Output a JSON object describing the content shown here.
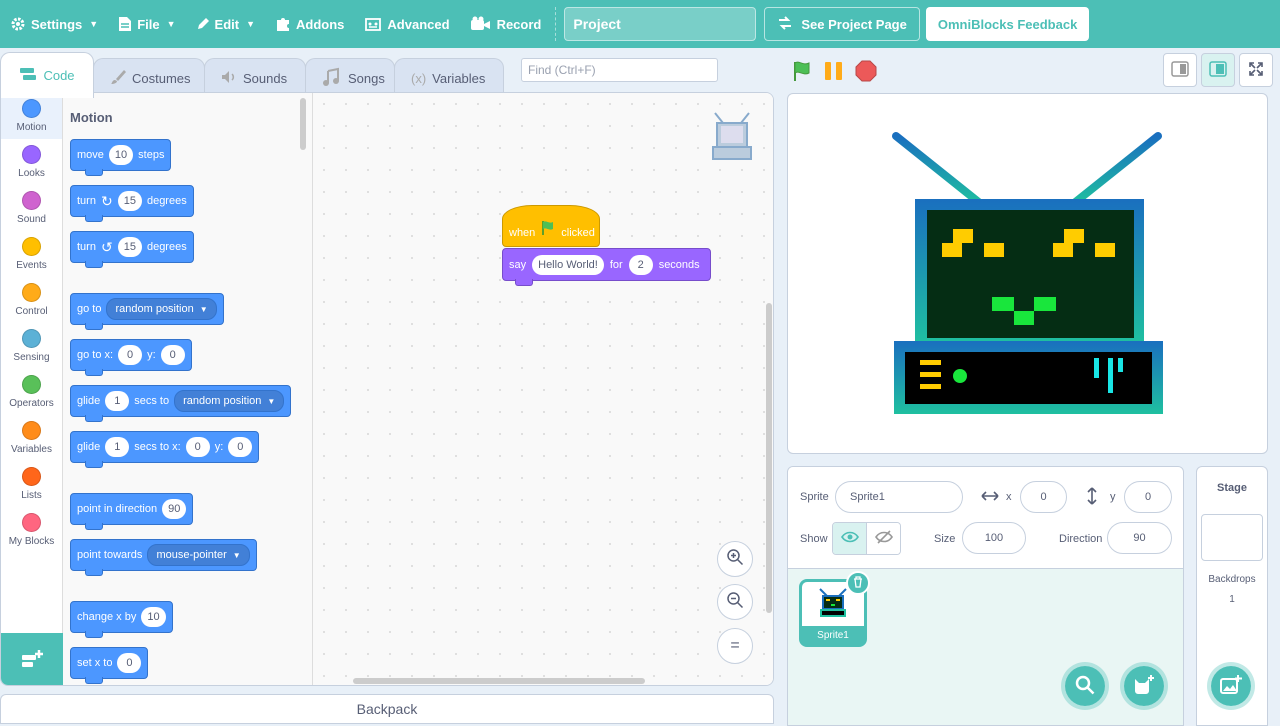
{
  "menu": {
    "settings": "Settings",
    "file": "File",
    "edit": "Edit",
    "addons": "Addons",
    "advanced": "Advanced",
    "record": "Record",
    "project_title": "Project",
    "see_project_page": "See Project Page",
    "feedback": "OmniBlocks Feedback"
  },
  "tabs": [
    {
      "label": "Code",
      "icon": "code-icon",
      "active": true
    },
    {
      "label": "Costumes",
      "icon": "brush-icon"
    },
    {
      "label": "Sounds",
      "icon": "speaker-icon"
    },
    {
      "label": "Songs",
      "icon": "music-note-icon"
    },
    {
      "label": "Variables",
      "icon": "variable-icon"
    }
  ],
  "search": {
    "placeholder": "Find (Ctrl+F)"
  },
  "categories": [
    {
      "label": "Motion",
      "color": "#4c97ff"
    },
    {
      "label": "Looks",
      "color": "#9966ff"
    },
    {
      "label": "Sound",
      "color": "#cf63cf"
    },
    {
      "label": "Events",
      "color": "#ffbf00"
    },
    {
      "label": "Control",
      "color": "#ffab19"
    },
    {
      "label": "Sensing",
      "color": "#5cb1d6"
    },
    {
      "label": "Operators",
      "color": "#59c059"
    },
    {
      "label": "Variables",
      "color": "#ff8c1a"
    },
    {
      "label": "Lists",
      "color": "#ff661a"
    },
    {
      "label": "My Blocks",
      "color": "#ff6680"
    }
  ],
  "palette": {
    "title": "Motion",
    "move": {
      "a": "move",
      "v": "10",
      "b": "steps"
    },
    "turn_right": {
      "a": "turn",
      "v": "15",
      "b": "degrees"
    },
    "turn_left": {
      "a": "turn",
      "v": "15",
      "b": "degrees"
    },
    "goto": {
      "a": "go to",
      "d": "random position"
    },
    "gotoxy": {
      "a": "go to x:",
      "x": "0",
      "b": "y:",
      "y": "0"
    },
    "glide_to": {
      "a": "glide",
      "v": "1",
      "b": "secs to",
      "d": "random position"
    },
    "glide_xy": {
      "a": "glide",
      "v": "1",
      "b": "secs to x:",
      "x": "0",
      "c": "y:",
      "y": "0"
    },
    "point_dir": {
      "a": "point in direction",
      "v": "90"
    },
    "point_towards": {
      "a": "point towards",
      "d": "mouse-pointer"
    },
    "change_x": {
      "a": "change x by",
      "v": "10"
    },
    "set_x": {
      "a": "set x to",
      "v": "0"
    }
  },
  "script": {
    "hat": {
      "a": "when",
      "b": "clicked"
    },
    "say": {
      "a": "say",
      "msg": "Hello World!",
      "b": "for",
      "v": "2",
      "c": "seconds"
    }
  },
  "backpack": "Backpack",
  "sprite_info": {
    "sprite_label": "Sprite",
    "sprite_name": "Sprite1",
    "x_label": "x",
    "x": "0",
    "y_label": "y",
    "y": "0",
    "show_label": "Show",
    "size_label": "Size",
    "size": "100",
    "direction_label": "Direction",
    "direction": "90"
  },
  "sprites": [
    {
      "name": "Sprite1"
    }
  ],
  "stage_panel": {
    "title": "Stage",
    "backdrops_label": "Backdrops",
    "backdrops_count": "1"
  }
}
